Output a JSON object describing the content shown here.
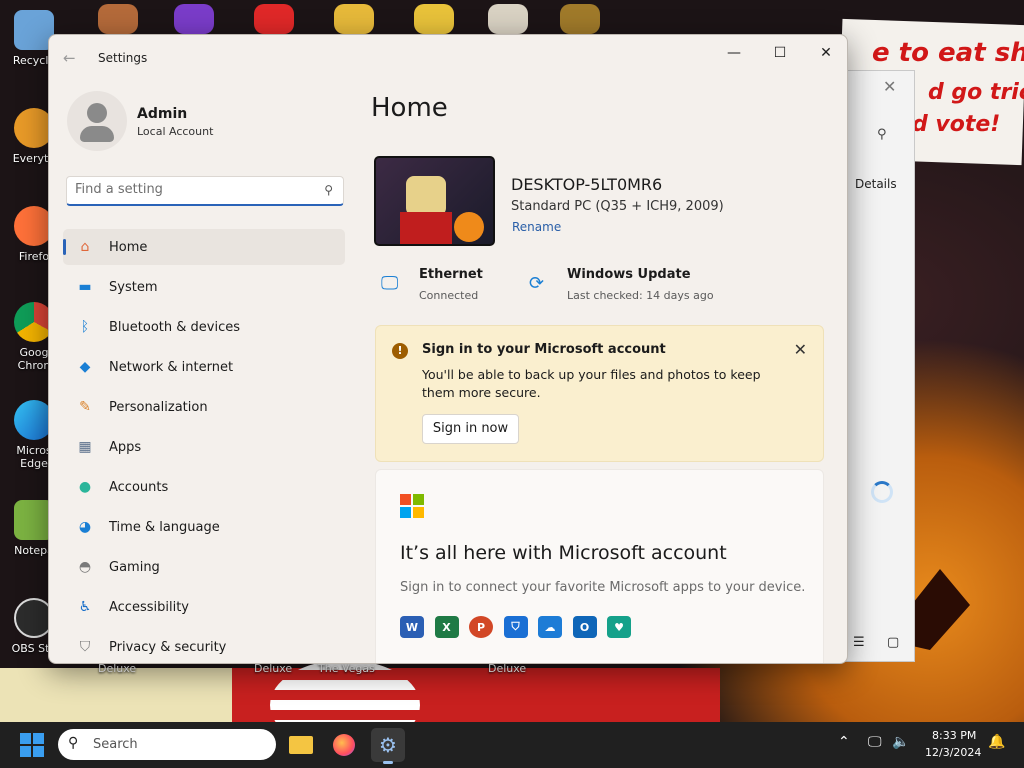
{
  "desktop": {
    "icons": [
      {
        "label": "Recycle",
        "color": "#6aa3d8"
      },
      {
        "label": "Everyth",
        "color": "#e89a28"
      },
      {
        "label": "Firefo",
        "color": "#ff7139"
      },
      {
        "label": "Goog\nChron",
        "color": "#4285f4"
      },
      {
        "label": "Micros\nEdge",
        "color": "#1a8ad4"
      },
      {
        "label": "Notepa",
        "color": "#7cb342"
      },
      {
        "label": "OBS Stu",
        "color": "#2c2c2c"
      }
    ],
    "bottom_labels": [
      "Deluxe",
      "Deluxe",
      "The Vegas",
      "Deluxe"
    ],
    "meme_lines": [
      "e to eat shit",
      "d go trick",
      "d vote!"
    ]
  },
  "bg_window": {
    "details_label": "Details"
  },
  "settings": {
    "app_title": "Settings",
    "profile": {
      "name": "Admin",
      "type": "Local Account"
    },
    "search_placeholder": "Find a setting",
    "nav": [
      {
        "label": "Home",
        "icon": "home-icon",
        "color": "#e0673a",
        "glyph": "⌂",
        "active": true
      },
      {
        "label": "System",
        "icon": "system-icon",
        "color": "#1a7fd4",
        "glyph": "▬",
        "active": false
      },
      {
        "label": "Bluetooth & devices",
        "icon": "bluetooth-icon",
        "color": "#1a7fd4",
        "glyph": "ᛒ",
        "active": false
      },
      {
        "label": "Network & internet",
        "icon": "wifi-icon",
        "color": "#1a7fd4",
        "glyph": "◆",
        "active": false
      },
      {
        "label": "Personalization",
        "icon": "brush-icon",
        "color": "#d9822b",
        "glyph": "✎",
        "active": false
      },
      {
        "label": "Apps",
        "icon": "apps-icon",
        "color": "#5a6f8a",
        "glyph": "▦",
        "active": false
      },
      {
        "label": "Accounts",
        "icon": "accounts-icon",
        "color": "#2bb59a",
        "glyph": "●",
        "active": false
      },
      {
        "label": "Time & language",
        "icon": "globe-clock-icon",
        "color": "#1a7fd4",
        "glyph": "◕",
        "active": false
      },
      {
        "label": "Gaming",
        "icon": "gamepad-icon",
        "color": "#7a7a7a",
        "glyph": "◓",
        "active": false
      },
      {
        "label": "Accessibility",
        "icon": "accessibility-icon",
        "color": "#1a6fc9",
        "glyph": "♿",
        "active": false
      },
      {
        "label": "Privacy & security",
        "icon": "shield-icon",
        "color": "#7a7a7a",
        "glyph": "⛉",
        "active": false
      }
    ],
    "page_title": "Home",
    "device": {
      "name": "DESKTOP-5LT0MR6",
      "spec": "Standard PC (Q35 + ICH9, 2009)",
      "rename_label": "Rename"
    },
    "status": {
      "network": {
        "title": "Ethernet",
        "sub": "Connected"
      },
      "update": {
        "title": "Windows Update",
        "sub": "Last checked: 14 days ago"
      }
    },
    "banner": {
      "title": "Sign in to your Microsoft account",
      "text": "You'll be able to back up your files and photos to keep them more secure.",
      "button": "Sign in now"
    },
    "ms_card": {
      "heading": "It’s all here with Microsoft account",
      "sub": "Sign in to connect your favorite Microsoft apps to your device.",
      "apps": [
        {
          "name": "word-icon",
          "letter": "W",
          "color": "#2b5fb4"
        },
        {
          "name": "excel-icon",
          "letter": "X",
          "color": "#1f7a45"
        },
        {
          "name": "powerpoint-icon",
          "letter": "P",
          "color": "#d24726"
        },
        {
          "name": "defender-icon",
          "letter": "⛉",
          "color": "#1a6fd4"
        },
        {
          "name": "onedrive-icon",
          "letter": "☁",
          "color": "#1d7cd6"
        },
        {
          "name": "outlook-icon",
          "letter": "O",
          "color": "#0f66b8"
        },
        {
          "name": "family-icon",
          "letter": "♥",
          "color": "#15a18a"
        }
      ]
    }
  },
  "taskbar": {
    "search_label": "Search",
    "time": "8:33 PM",
    "date": "12/3/2024"
  },
  "colors": {
    "accent": "#2a63b8",
    "banner_bg": "#faefcf",
    "taskbar_bg": "#202020"
  }
}
